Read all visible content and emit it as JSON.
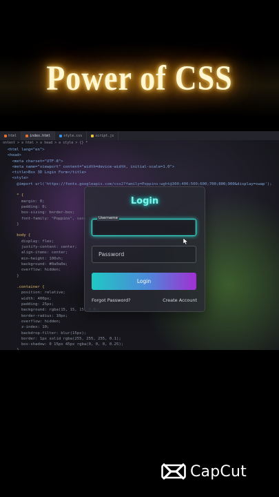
{
  "title": "Power of CSS",
  "editor": {
    "tabs": [
      {
        "label": "html",
        "color": "#e4712f",
        "active": false
      },
      {
        "label": "index.html",
        "color": "#e4712f",
        "active": true
      },
      {
        "label": "style.css",
        "color": "#3a8ee6",
        "active": false
      },
      {
        "label": "script.js",
        "color": "#e8c63a",
        "active": false
      }
    ],
    "breadcrumb": "ontent > ⊘ html > ⊘ head > ⊘ style > {} *",
    "code_lines": [
      "  <html lang=\"en\">",
      "  <head>",
      "    <meta charset=\"UTF-8\">",
      "    <meta name=\"viewport\" content=\"width=device-width, initial-scale=1.0\">",
      "    <title>Box 3D Login Form</title>",
      "    <style>",
      "      @import url('https://fonts.googleapis.com/css2?family=Poppins:wght@300;400;500;600;700;800;900&display=swap');",
      "",
      "      * {",
      "        margin: 0;",
      "        padding: 0;",
      "        box-sizing: border-box;",
      "        font-family: \"Poppins\", sans-serif;",
      "      }",
      "",
      "      body {",
      "        display: flex;",
      "        justify-content: center;",
      "        align-items: center;",
      "        min-height: 100vh;",
      "        background: #0a0a0a;",
      "        overflow: hidden;",
      "      }",
      "",
      "      .container {",
      "        position: relative;",
      "        width: 400px;",
      "        padding: 25px;",
      "        background: rgba(15, 15, 15, 0.8);",
      "        border-radius: 10px;",
      "        overflow: hidden;",
      "        z-index: 10;",
      "        backdrop-filter: blur(15px);",
      "        border: 1px solid rgba(255, 255, 255, 0.1);",
      "        box-shadow: 0 15px 45px rgba(0, 0, 0, 0.25);",
      "      }"
    ]
  },
  "login": {
    "title": "Login",
    "username_label": "Username",
    "password_placeholder": "Password",
    "button_label": "Login",
    "forgot_link": "Forgot Password?",
    "create_link": "Create Account"
  },
  "watermark": {
    "label": "CapCut",
    "icon": "capcut-logo-icon"
  }
}
